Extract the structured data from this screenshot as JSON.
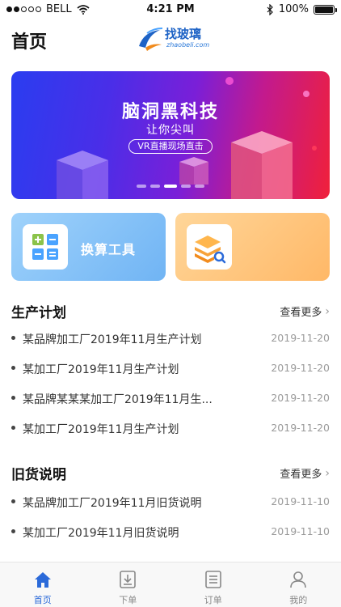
{
  "status_bar": {
    "carrier": "BELL",
    "time": "4:21 PM",
    "battery": "100%",
    "signal_icon": "signal-dots-icon",
    "wifi_icon": "wifi-icon",
    "bluetooth_icon": "bluetooth-icon"
  },
  "header": {
    "title": "首页",
    "logo_text": "找玻璃",
    "logo_sub": "zhaobeli.com"
  },
  "banner": {
    "headline": "脑洞黑科技",
    "subline": "让你尖叫",
    "cta": "VR直播现场直击",
    "active_page": 3,
    "page_count": 5
  },
  "tools": [
    {
      "label": "换算工具",
      "icon": "calculator-icon"
    },
    {
      "label": "",
      "icon": "stack-search-icon"
    }
  ],
  "production_plan": {
    "title": "生产计划",
    "more": "查看更多",
    "items": [
      {
        "title": "某品牌加工厂2019年11月生产计划",
        "date": "2019-11-20"
      },
      {
        "title": "某加工厂2019年11月生产计划",
        "date": "2019-11-20"
      },
      {
        "title": "某品牌某某某加工厂2019年11月生...",
        "date": "2019-11-20"
      },
      {
        "title": "某加工厂2019年11月生产计划",
        "date": "2019-11-20"
      }
    ]
  },
  "old_goods": {
    "title": "旧货说明",
    "more": "查看更多",
    "items": [
      {
        "title": "某品牌加工厂2019年11月旧货说明",
        "date": "2019-11-10"
      },
      {
        "title": "某加工厂2019年11月旧货说明",
        "date": "2019-11-10"
      }
    ]
  },
  "tabbar": {
    "tabs": [
      {
        "label": "首页",
        "icon": "home-icon",
        "active": true
      },
      {
        "label": "下单",
        "icon": "download-order-icon",
        "active": false
      },
      {
        "label": "订单",
        "icon": "order-list-icon",
        "active": false
      },
      {
        "label": "我的",
        "icon": "user-icon",
        "active": false
      }
    ],
    "active_color": "#2b6ad9"
  },
  "colors": {
    "banner_start": "#2a3df0",
    "banner_end": "#f0203a",
    "card_blue": "#70b4f4",
    "card_orange": "#ffb867",
    "brand_blue": "#1e63c6"
  }
}
